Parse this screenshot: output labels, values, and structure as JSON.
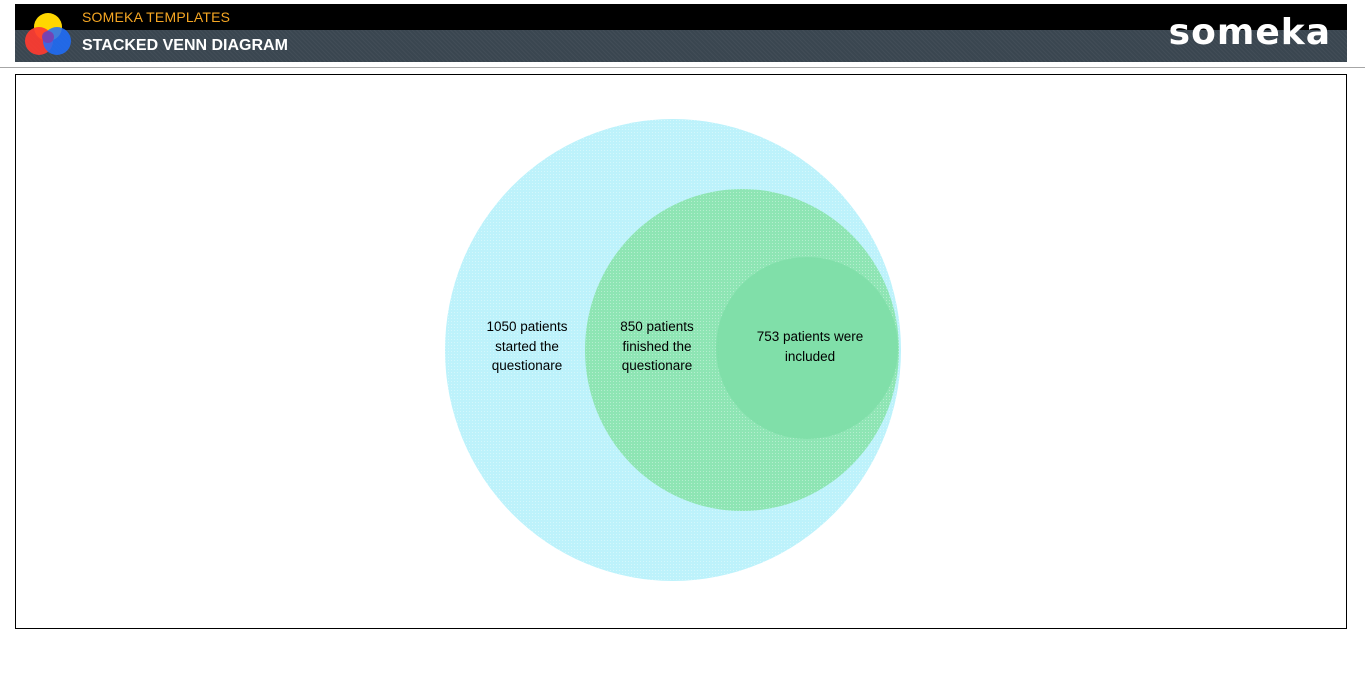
{
  "header": {
    "brand_sub": "SOMEKA TEMPLATES",
    "title": "STACKED VENN DIAGRAM",
    "wordmark": "someka"
  },
  "colors": {
    "header_bg": "#000000",
    "header_band": "#3a4650",
    "brand_sub": "#f5a623",
    "outer_circle": "#bdf2fb",
    "middle_circle": "#8ee5b4",
    "inner_circle": "#80dfa9"
  },
  "venn": {
    "circles": [
      {
        "id": "outer",
        "label": "1050 patients\nstarted the\nquestionare",
        "value": 1050
      },
      {
        "id": "middle",
        "label": "850 patients\nfinished the\nquestionare",
        "value": 850
      },
      {
        "id": "inner",
        "label": "753 patients were\nincluded",
        "value": 753
      }
    ]
  }
}
